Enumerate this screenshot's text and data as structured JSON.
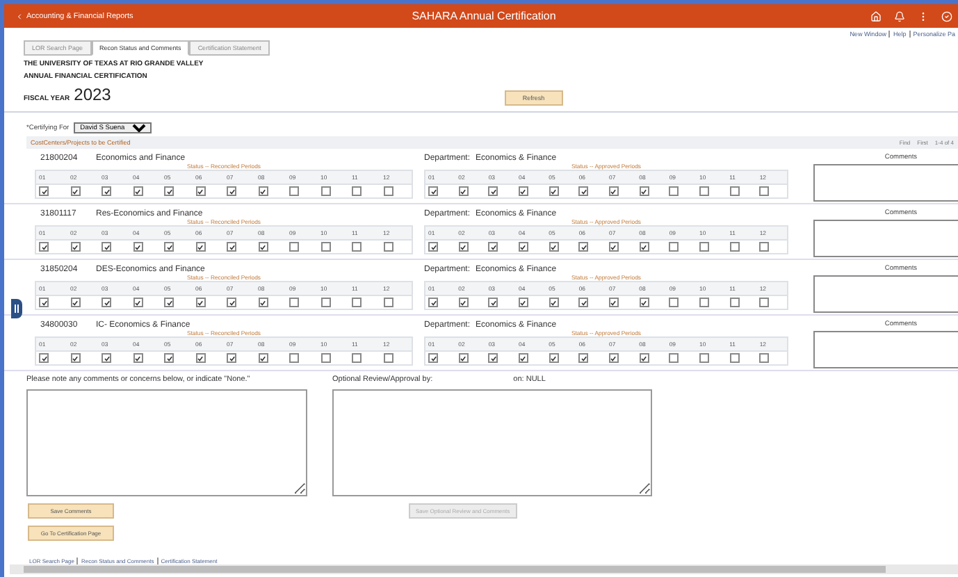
{
  "header": {
    "back_link": "Accounting & Financial Reports",
    "title": "SAHARA Annual Certification"
  },
  "utility_links": [
    "New Window",
    "Help",
    "Personalize Pa"
  ],
  "tabs": [
    {
      "label": "LOR Search Page",
      "selected": false
    },
    {
      "label": "Recon Status and Comments",
      "selected": true
    },
    {
      "label": "Certification Statement",
      "selected": false
    }
  ],
  "institution": "THE UNIVERSITY OF TEXAS AT RIO GRANDE VALLEY",
  "report_title": "ANNUAL FINANCIAL CERTIFICATION",
  "fiscal_year": {
    "label": "FISCAL YEAR",
    "value": "2023"
  },
  "refresh_button": "Refresh",
  "certifying_for": {
    "label": "*Certifying For",
    "value": "David S Suena"
  },
  "grid": {
    "title": "CostCenters/Projects to be Certified",
    "nav": [
      "Find",
      "First",
      "1-4 of 4"
    ]
  },
  "cost_centers": [
    {
      "id": "21800204",
      "name": "Economics and Finance",
      "department_label": "Department:",
      "department": "Economics & Finance",
      "comments_label": "Comments",
      "reconciled": {
        "title": "Status -- Reconciled Periods",
        "periods": [
          {
            "label": "01",
            "checked": true
          },
          {
            "label": "02",
            "checked": true
          },
          {
            "label": "03",
            "checked": true
          },
          {
            "label": "04",
            "checked": true
          },
          {
            "label": "05",
            "checked": true
          },
          {
            "label": "06",
            "checked": true
          },
          {
            "label": "07",
            "checked": true
          },
          {
            "label": "08",
            "checked": true
          },
          {
            "label": "09",
            "checked": false
          },
          {
            "label": "10",
            "checked": false
          },
          {
            "label": "11",
            "checked": false
          },
          {
            "label": "12",
            "checked": false
          }
        ]
      },
      "approved": {
        "title": "Status -- Approved Periods",
        "periods": [
          {
            "label": "01",
            "checked": true
          },
          {
            "label": "02",
            "checked": true
          },
          {
            "label": "03",
            "checked": true
          },
          {
            "label": "04",
            "checked": true
          },
          {
            "label": "05",
            "checked": true
          },
          {
            "label": "06",
            "checked": true
          },
          {
            "label": "07",
            "checked": true
          },
          {
            "label": "08",
            "checked": true
          },
          {
            "label": "09",
            "checked": false
          },
          {
            "label": "10",
            "checked": false
          },
          {
            "label": "11",
            "checked": false
          },
          {
            "label": "12",
            "checked": false
          }
        ]
      }
    },
    {
      "id": "31801117",
      "name": "Res-Economics and Finance",
      "department_label": "Department:",
      "department": "Economics & Finance",
      "comments_label": "Comments",
      "reconciled": {
        "title": "Status -- Reconciled Periods",
        "periods": [
          {
            "label": "01",
            "checked": true
          },
          {
            "label": "02",
            "checked": true
          },
          {
            "label": "03",
            "checked": true
          },
          {
            "label": "04",
            "checked": true
          },
          {
            "label": "05",
            "checked": true
          },
          {
            "label": "06",
            "checked": true
          },
          {
            "label": "07",
            "checked": true
          },
          {
            "label": "08",
            "checked": true
          },
          {
            "label": "09",
            "checked": false
          },
          {
            "label": "10",
            "checked": false
          },
          {
            "label": "11",
            "checked": false
          },
          {
            "label": "12",
            "checked": false
          }
        ]
      },
      "approved": {
        "title": "Status -- Approved Periods",
        "periods": [
          {
            "label": "01",
            "checked": true
          },
          {
            "label": "02",
            "checked": true
          },
          {
            "label": "03",
            "checked": true
          },
          {
            "label": "04",
            "checked": true
          },
          {
            "label": "05",
            "checked": true
          },
          {
            "label": "06",
            "checked": true
          },
          {
            "label": "07",
            "checked": true
          },
          {
            "label": "08",
            "checked": true
          },
          {
            "label": "09",
            "checked": false
          },
          {
            "label": "10",
            "checked": false
          },
          {
            "label": "11",
            "checked": false
          },
          {
            "label": "12",
            "checked": false
          }
        ]
      }
    },
    {
      "id": "31850204",
      "name": "DES-Economics and Finance",
      "department_label": "Department:",
      "department": "Economics & Finance",
      "comments_label": "Comments",
      "reconciled": {
        "title": "Status -- Reconciled Periods",
        "periods": [
          {
            "label": "01",
            "checked": true
          },
          {
            "label": "02",
            "checked": true
          },
          {
            "label": "03",
            "checked": true
          },
          {
            "label": "04",
            "checked": true
          },
          {
            "label": "05",
            "checked": true
          },
          {
            "label": "06",
            "checked": true
          },
          {
            "label": "07",
            "checked": true
          },
          {
            "label": "08",
            "checked": true
          },
          {
            "label": "09",
            "checked": false
          },
          {
            "label": "10",
            "checked": false
          },
          {
            "label": "11",
            "checked": false
          },
          {
            "label": "12",
            "checked": false
          }
        ]
      },
      "approved": {
        "title": "Status -- Approved Periods",
        "periods": [
          {
            "label": "01",
            "checked": true
          },
          {
            "label": "02",
            "checked": true
          },
          {
            "label": "03",
            "checked": true
          },
          {
            "label": "04",
            "checked": true
          },
          {
            "label": "05",
            "checked": true
          },
          {
            "label": "06",
            "checked": true
          },
          {
            "label": "07",
            "checked": true
          },
          {
            "label": "08",
            "checked": true
          },
          {
            "label": "09",
            "checked": false
          },
          {
            "label": "10",
            "checked": false
          },
          {
            "label": "11",
            "checked": false
          },
          {
            "label": "12",
            "checked": false
          }
        ]
      }
    },
    {
      "id": "34800030",
      "name": "IC- Economics & Finance",
      "department_label": "Department:",
      "department": "Economics & Finance",
      "comments_label": "Comments",
      "reconciled": {
        "title": "Status -- Reconciled Periods",
        "periods": [
          {
            "label": "01",
            "checked": true
          },
          {
            "label": "02",
            "checked": true
          },
          {
            "label": "03",
            "checked": true
          },
          {
            "label": "04",
            "checked": true
          },
          {
            "label": "05",
            "checked": true
          },
          {
            "label": "06",
            "checked": true
          },
          {
            "label": "07",
            "checked": true
          },
          {
            "label": "08",
            "checked": true
          },
          {
            "label": "09",
            "checked": false
          },
          {
            "label": "10",
            "checked": false
          },
          {
            "label": "11",
            "checked": false
          },
          {
            "label": "12",
            "checked": false
          }
        ]
      },
      "approved": {
        "title": "Status -- Approved Periods",
        "periods": [
          {
            "label": "01",
            "checked": true
          },
          {
            "label": "02",
            "checked": true
          },
          {
            "label": "03",
            "checked": true
          },
          {
            "label": "04",
            "checked": true
          },
          {
            "label": "05",
            "checked": true
          },
          {
            "label": "06",
            "checked": true
          },
          {
            "label": "07",
            "checked": true
          },
          {
            "label": "08",
            "checked": true
          },
          {
            "label": "09",
            "checked": false
          },
          {
            "label": "10",
            "checked": false
          },
          {
            "label": "11",
            "checked": false
          },
          {
            "label": "12",
            "checked": false
          }
        ]
      }
    }
  ],
  "comments": {
    "label": "Please note any comments or concerns below, or indicate \"None.\""
  },
  "review": {
    "label": "Optional Review/Approval by:",
    "on_label": "on:",
    "on_value": "NULL"
  },
  "buttons": {
    "save_comments": {
      "label": "Save Comments",
      "disabled": false
    },
    "go_certification": {
      "label": "Go To Certification Page",
      "disabled": false
    },
    "save_review": {
      "label": "Save Optional Review and Comments",
      "disabled": true
    }
  },
  "footer_links": [
    "LOR Search Page",
    "Recon Status and Comments",
    "Certification Statement"
  ]
}
